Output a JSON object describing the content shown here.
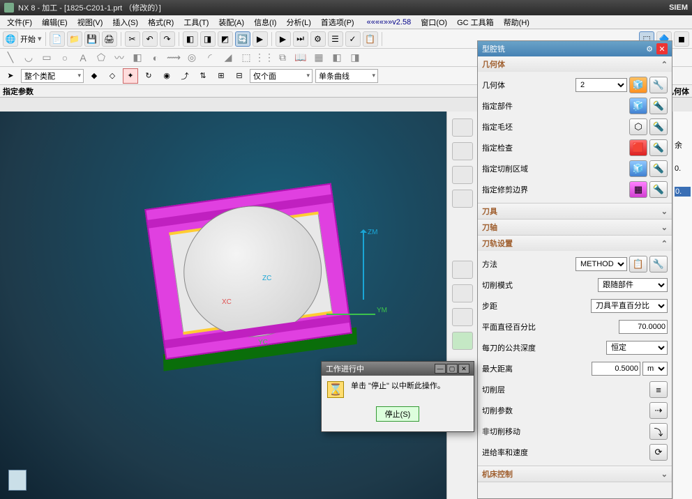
{
  "titlebar": {
    "text": "NX 8 - 加工 - [1825-C201-1.prt （修改的）]",
    "brand": "SIEM"
  },
  "menubar": {
    "items": [
      "文件(F)",
      "编辑(E)",
      "视图(V)",
      "插入(S)",
      "格式(R)",
      "工具(T)",
      "装配(A)",
      "信息(I)",
      "分析(L)",
      "首选项(P)"
    ],
    "version": "««««»»v2.58",
    "items2": [
      "窗口(O)",
      "GC 工具箱",
      "帮助(H)"
    ]
  },
  "toolbar1": {
    "start": "开始"
  },
  "toolbar3": {
    "drop1": "整个类配",
    "drop2": "仅个面",
    "drop3": "单条曲线"
  },
  "status": {
    "left": "指定参数",
    "right": "正在追踪以下层上的部件几何体"
  },
  "axes": {
    "z": "ZM",
    "y": "YM",
    "x": "XC",
    "yc": "YC",
    "zc": "ZC"
  },
  "panel": {
    "title": "型腔铣",
    "sec_geom": "几何体",
    "geom": {
      "label": "几何体",
      "value": "2",
      "rows": [
        "指定部件",
        "指定毛坯",
        "指定检查",
        "指定切削区域",
        "指定修剪边界"
      ]
    },
    "sec_tool": "刀具",
    "sec_axis": "刀轴",
    "sec_paths": "刀轨设置",
    "paths": {
      "method_lbl": "方法",
      "method_val": "METHOD",
      "cutmode_lbl": "切削模式",
      "cutmode_val": "跟随部件",
      "step_lbl": "步距",
      "step_val": "刀具平直百分比",
      "planepct_lbl": "平面直径百分比",
      "planepct_val": "70.0000",
      "perdepth_lbl": "每刀的公共深度",
      "perdepth_val": "恒定",
      "maxdist_lbl": "最大距离",
      "maxdist_val": "0.5000",
      "maxdist_unit": "mm",
      "cutlayer": "切削层",
      "cutparam": "切削参数",
      "noncut": "非切削移动",
      "feedspeed": "进给率和速度"
    },
    "sec_machine": "机床控制"
  },
  "rightedge": {
    "a": "余",
    "b": "0.",
    "c": "0."
  },
  "modal": {
    "title": "工作进行中",
    "message": "单击 \"停止\" 以中断此操作。",
    "stop": "停止(S)"
  }
}
